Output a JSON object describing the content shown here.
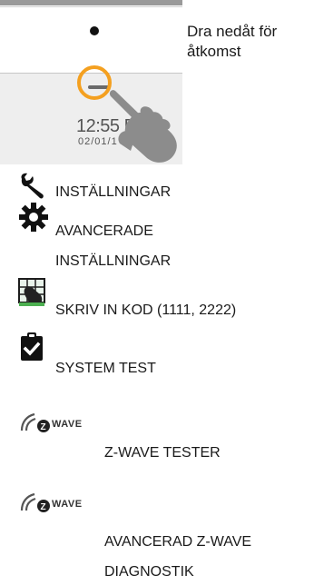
{
  "instruction": {
    "line1": "Dra nedåt för",
    "line2": "åtkomst"
  },
  "device": {
    "time": "12:55 P",
    "date": "02/01/1"
  },
  "menu": {
    "settings": "INSTÄLLNINGAR",
    "advanced_settings_line1": "AVANCERADE",
    "advanced_settings_line2": "INSTÄLLNINGAR",
    "enter_code": "SKRIV IN KOD (1111, 2222)",
    "system_test": "SYSTEM TEST",
    "zwave_tester": "Z-WAVE TESTER",
    "zwave_diag_line1": "AVANCERAD Z-WAVE",
    "zwave_diag_line2": "DIAGNOSTIK"
  },
  "zwave_logo_text": "WAVE",
  "colors": {
    "accent_ring": "#f4a020",
    "text": "#1a1a1a",
    "icon": "#111111"
  },
  "icons": [
    "wrench-icon",
    "gear-icon",
    "keypad-hand-icon",
    "clipboard-check-icon",
    "zwave-logo-icon"
  ]
}
